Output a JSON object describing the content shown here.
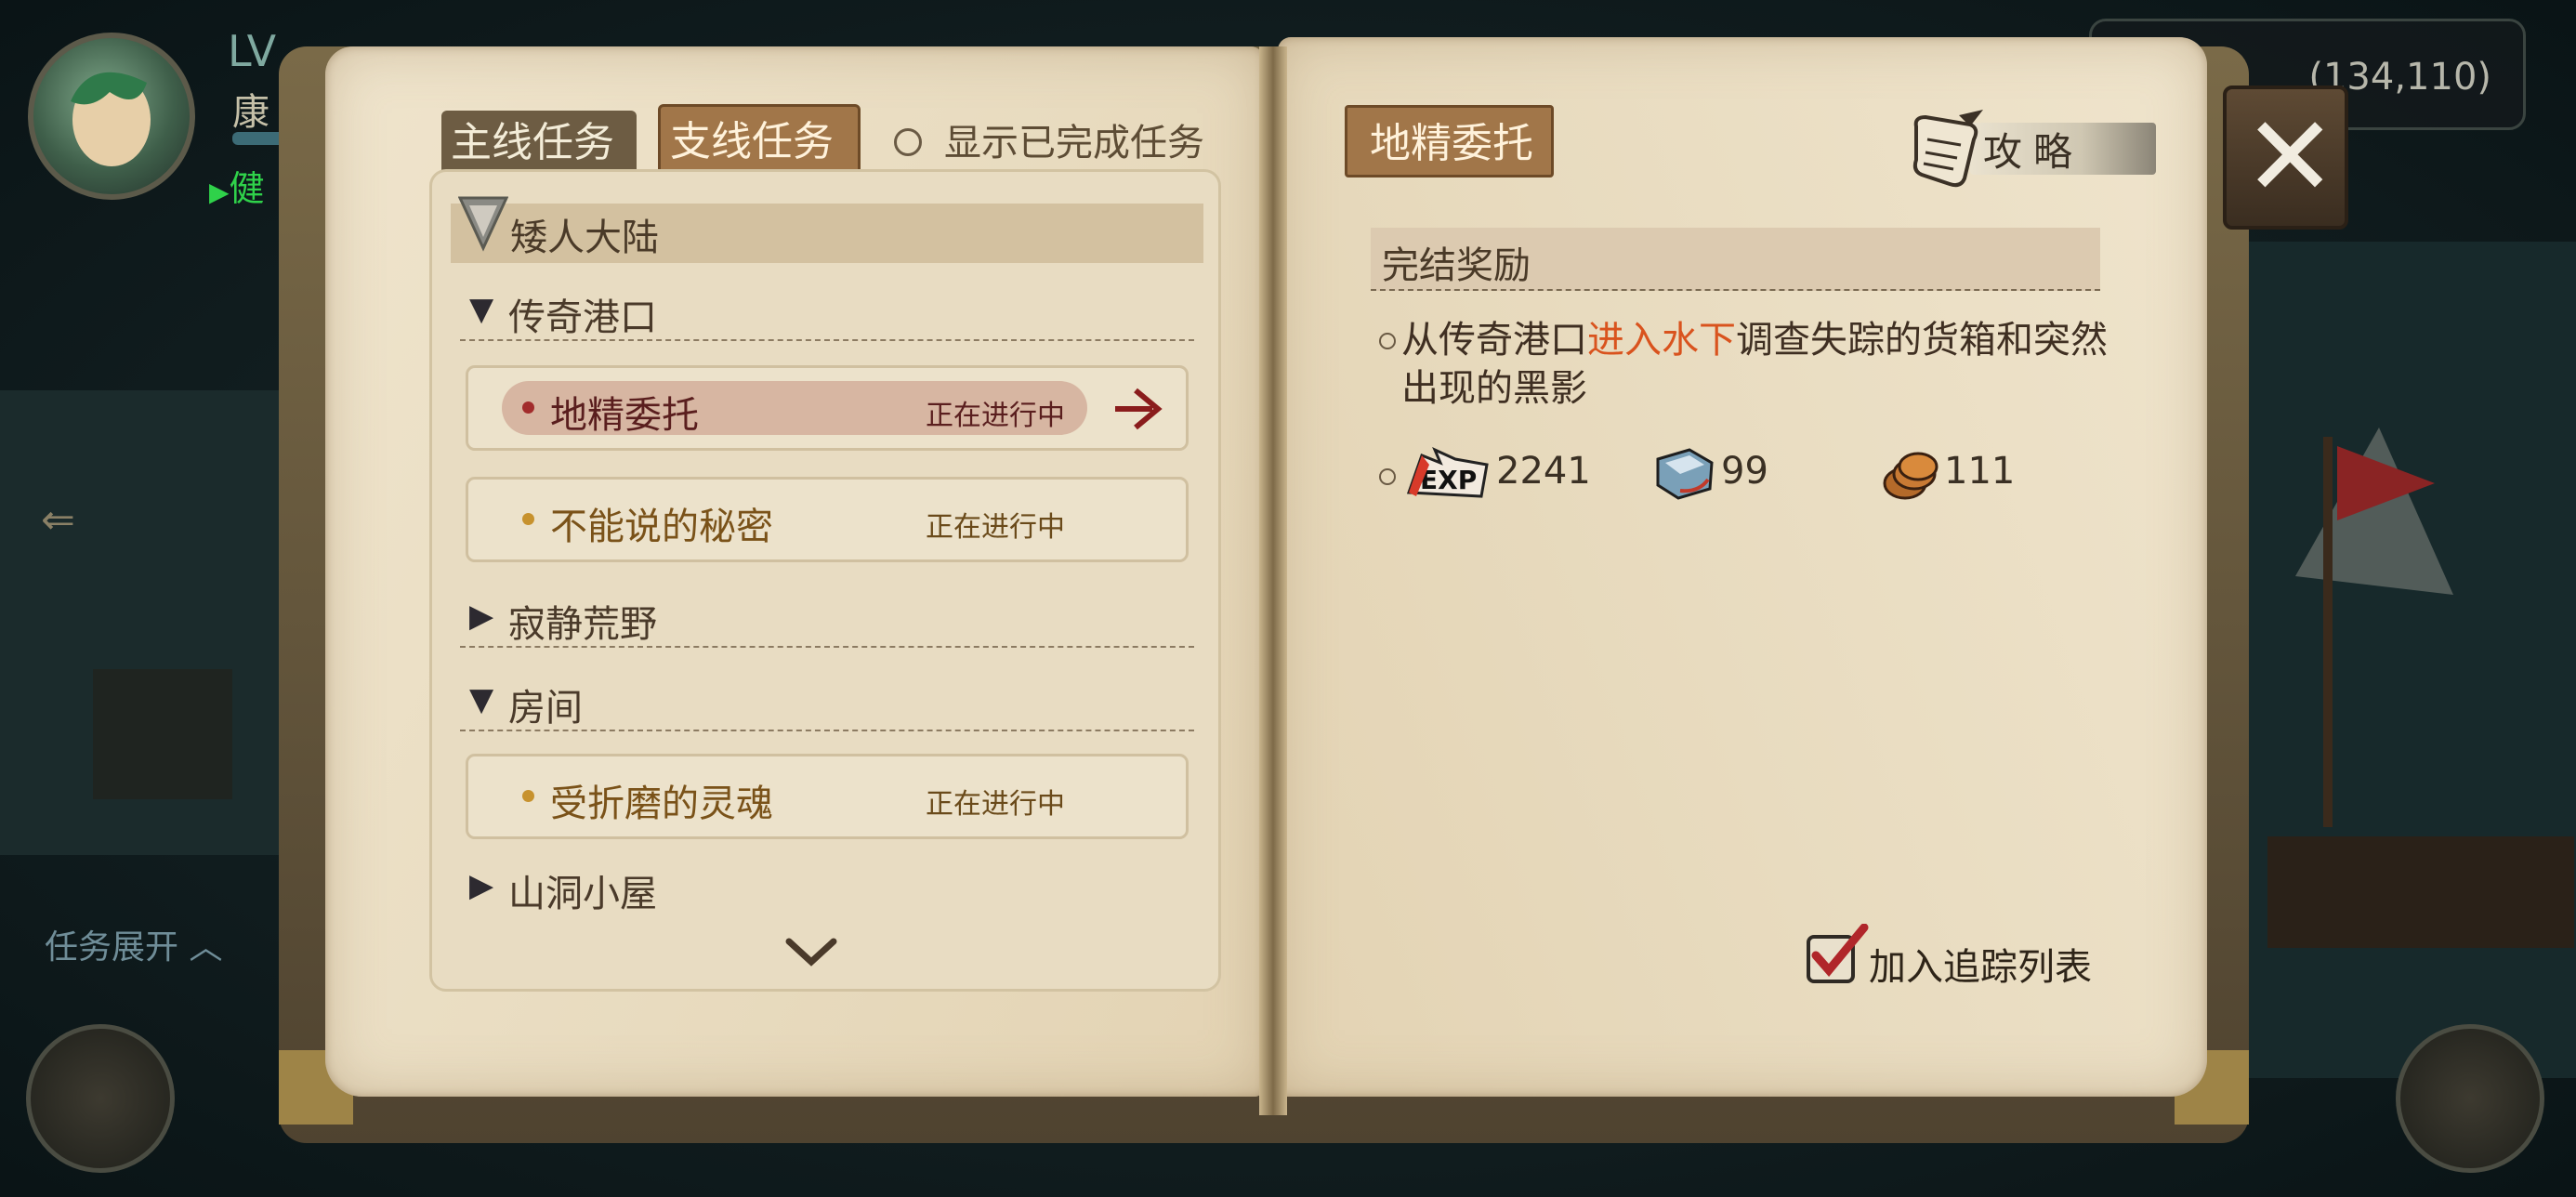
{
  "hud": {
    "level_label": "LV",
    "player_name": "康",
    "status": "健",
    "task_expand": "任务展开 ︿",
    "coordinates": "(134,110)"
  },
  "tabs": {
    "main": "主线任务",
    "side": "支线任务",
    "show_completed": "显示已完成任务"
  },
  "quest_list": {
    "region": "矮人大陆",
    "areas": [
      {
        "name": "传奇港口",
        "expanded": true
      },
      {
        "name": "寂静荒野",
        "expanded": false
      },
      {
        "name": "房间",
        "expanded": true
      },
      {
        "name": "山洞小屋",
        "expanded": false
      }
    ],
    "quests": [
      {
        "name": "地精委托",
        "status": "正在进行中",
        "active": true
      },
      {
        "name": "不能说的秘密",
        "status": "正在进行中",
        "active": false
      },
      {
        "name": "受折磨的灵魂",
        "status": "正在进行中",
        "active": false
      }
    ]
  },
  "detail": {
    "title": "地精委托",
    "guide_label": "攻略",
    "reward_header": "完结奖励",
    "desc_before": "从传奇港口",
    "desc_highlight": "进入水下",
    "desc_after": "调查失踪的货箱和突然出现的黑影",
    "rewards": [
      {
        "icon": "exp-icon",
        "value": "2241"
      },
      {
        "icon": "book-item-icon",
        "value": "99"
      },
      {
        "icon": "coins-icon",
        "value": "111"
      }
    ],
    "track_label": "加入追踪列表",
    "track_checked": true
  },
  "colors": {
    "accent_tab": "#a17649",
    "highlight_text": "#d9531e",
    "active_quest": "#a22c2c"
  }
}
